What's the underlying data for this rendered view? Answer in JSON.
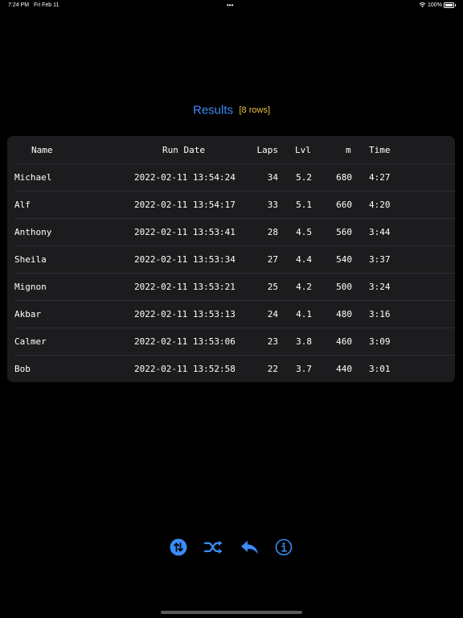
{
  "status_bar": {
    "time": "7:24 PM",
    "date": "Fri Feb 11",
    "dots": "•••",
    "battery_percent": "100%"
  },
  "title": {
    "text": "Results",
    "count": "[8 rows]"
  },
  "table": {
    "headers": {
      "name": "Name",
      "run_date": "Run Date",
      "laps": "Laps",
      "lvl": "Lvl",
      "m": "m",
      "time": "Time"
    },
    "rows": [
      {
        "name": "Michael",
        "run_date": "2022-02-11 13:54:24",
        "laps": "34",
        "lvl": "5.2",
        "m": "680",
        "time": "4:27"
      },
      {
        "name": "Alf",
        "run_date": "2022-02-11 13:54:17",
        "laps": "33",
        "lvl": "5.1",
        "m": "660",
        "time": "4:20"
      },
      {
        "name": "Anthony",
        "run_date": "2022-02-11 13:53:41",
        "laps": "28",
        "lvl": "4.5",
        "m": "560",
        "time": "3:44"
      },
      {
        "name": "Sheila",
        "run_date": "2022-02-11 13:53:34",
        "laps": "27",
        "lvl": "4.4",
        "m": "540",
        "time": "3:37"
      },
      {
        "name": "Mignon",
        "run_date": "2022-02-11 13:53:21",
        "laps": "25",
        "lvl": "4.2",
        "m": "500",
        "time": "3:24"
      },
      {
        "name": "Akbar",
        "run_date": "2022-02-11 13:53:13",
        "laps": "24",
        "lvl": "4.1",
        "m": "480",
        "time": "3:16"
      },
      {
        "name": "Calmer",
        "run_date": "2022-02-11 13:53:06",
        "laps": "23",
        "lvl": "3.8",
        "m": "460",
        "time": "3:09"
      },
      {
        "name": "Bob",
        "run_date": "2022-02-11 13:52:58",
        "laps": "22",
        "lvl": "3.7",
        "m": "440",
        "time": "3:01"
      }
    ]
  },
  "toolbar": {
    "icons": [
      "sort-icon",
      "shuffle-icon",
      "reply-icon",
      "info-icon"
    ]
  },
  "colors": {
    "accent": "#3b8cf5",
    "count": "#e8c23c",
    "table_bg": "#1c1c1e",
    "background": "#000000"
  }
}
